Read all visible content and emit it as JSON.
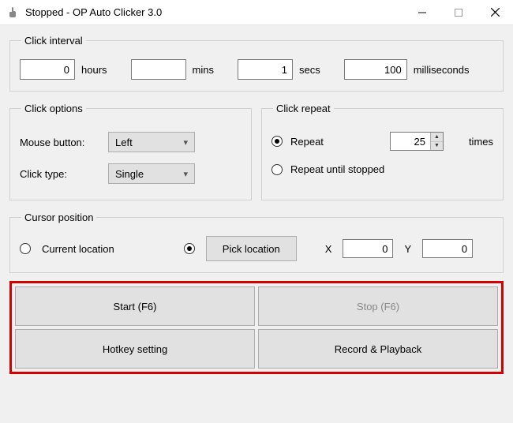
{
  "window": {
    "title": "Stopped - OP Auto Clicker 3.0"
  },
  "interval": {
    "legend": "Click interval",
    "hours": "0",
    "hours_unit": "hours",
    "mins": "",
    "mins_unit": "mins",
    "secs": "1",
    "secs_unit": "secs",
    "ms": "100",
    "ms_unit": "milliseconds"
  },
  "options": {
    "legend": "Click options",
    "mouse_label": "Mouse button:",
    "mouse_value": "Left",
    "type_label": "Click type:",
    "type_value": "Single"
  },
  "repeat": {
    "legend": "Click repeat",
    "repeat_label": "Repeat",
    "repeat_value": "25",
    "times_label": "times",
    "until_label": "Repeat until stopped"
  },
  "cursor": {
    "legend": "Cursor position",
    "current_label": "Current location",
    "pick_label": "Pick location",
    "x_label": "X",
    "x_value": "0",
    "y_label": "Y",
    "y_value": "0"
  },
  "actions": {
    "start": "Start (F6)",
    "stop": "Stop (F6)",
    "hotkey": "Hotkey setting",
    "record": "Record & Playback"
  }
}
